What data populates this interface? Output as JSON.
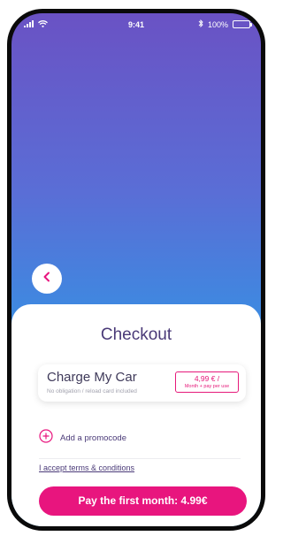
{
  "status_bar": {
    "time": "9:41",
    "battery": "100%"
  },
  "checkout": {
    "title": "Checkout",
    "plan": {
      "name": "Charge My Car",
      "subtitle": "No obligation / reload card included",
      "price": "4,99 € /",
      "price_detail": "Month + pay per use"
    },
    "promo_label": "Add a promocode",
    "terms_label": "I accept terms & conditions",
    "pay_button_label": "Pay the first month: 4.99€"
  },
  "colors": {
    "accent": "#e8157e",
    "title": "#4a3a78",
    "gradient_top": "#6a52c4",
    "gradient_bottom": "#2e9ce8"
  }
}
